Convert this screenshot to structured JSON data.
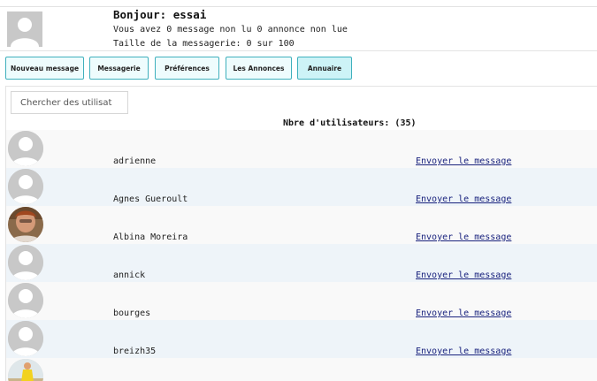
{
  "header": {
    "greeting": "Bonjour: essai",
    "unread_info": "Vous avez 0 message non lu 0 annonce non lue",
    "storage_info": "Taille de la messagerie: 0 sur 100"
  },
  "nav": {
    "items": [
      {
        "label": "Nouveau message",
        "active": false
      },
      {
        "label": "Messagerie",
        "active": false
      },
      {
        "label": "Préférences",
        "active": false
      },
      {
        "label": "Les Annonces",
        "active": false
      },
      {
        "label": "Annuaire",
        "active": true
      }
    ]
  },
  "search": {
    "placeholder": "Chercher des utilisat"
  },
  "directory": {
    "count_label": "Nbre d'utilisateurs: (35)",
    "send_label": "Envoyer le message",
    "users": [
      {
        "name": "adrienne",
        "avatar": "default-avatar-icon"
      },
      {
        "name": "Agnes Gueroult",
        "avatar": "default-avatar-icon"
      },
      {
        "name": "Albina Moreira",
        "avatar": "photo-avatar"
      },
      {
        "name": "annick",
        "avatar": "default-avatar-icon"
      },
      {
        "name": "bourges",
        "avatar": "default-avatar-icon"
      },
      {
        "name": "breizh35",
        "avatar": "default-avatar-icon"
      },
      {
        "name": "",
        "avatar": "photo-avatar"
      }
    ]
  },
  "colors": {
    "button_border": "#3fb0bd",
    "button_bg": "#eefcfd",
    "active_button_bg": "#cdf3f7",
    "link": "#1a237e",
    "row_alt": "#eef4f9"
  }
}
